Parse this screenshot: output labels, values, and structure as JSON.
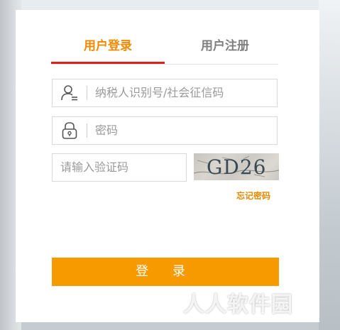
{
  "tabs": {
    "login": "用户登录",
    "register": "用户注册"
  },
  "fields": {
    "taxpayer_id_placeholder": "纳税人识别号/社会征信码",
    "password_placeholder": "密码",
    "captcha_placeholder": "请输入验证码"
  },
  "captcha": {
    "code": "GD26"
  },
  "links": {
    "forgot_password": "忘记密码"
  },
  "buttons": {
    "login": "登 录"
  },
  "watermark": "人人软件园",
  "colors": {
    "accent": "#f79a00",
    "tab_active": "#f08a00",
    "tab_underline": "#e21d1d"
  },
  "icons": {
    "user": "user-icon",
    "lock": "lock-icon"
  }
}
